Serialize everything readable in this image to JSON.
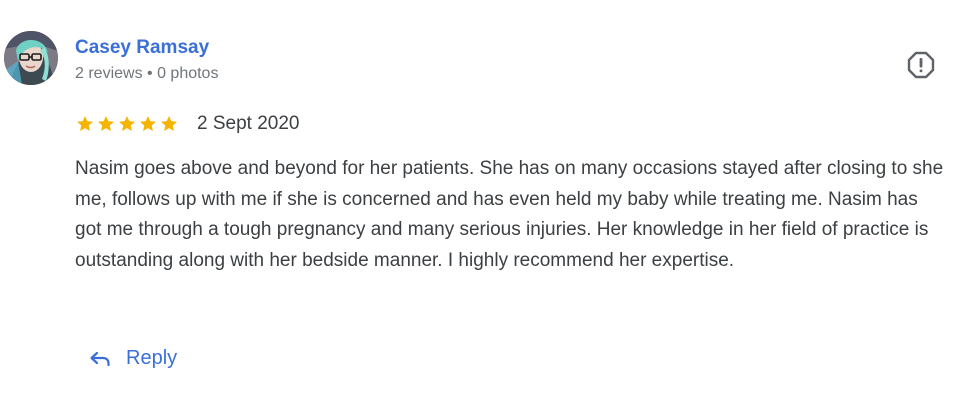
{
  "review": {
    "author": {
      "name": "Casey Ramsay",
      "meta": "2 reviews • 0 photos",
      "avatar_icon": "profile-photo"
    },
    "rating": 5,
    "rating_max": 5,
    "date": "2 Sept 2020",
    "text": "Nasim goes above and beyond for her patients. She has on many occasions stayed after closing to she me, follows up with me if she is concerned and has even held my baby while treating me. Nasim has got me through a tough pregnancy and many serious injuries. Her knowledge in her field of practice is outstanding along with her bedside manner. I highly recommend her expertise.",
    "actions": {
      "reply_label": "Reply",
      "reply_icon": "reply-arrow-icon",
      "flag_icon": "report-flag-icon"
    }
  },
  "colors": {
    "accent": "#3a6fd8",
    "star": "#f4b400",
    "text": "#3c4043",
    "muted": "#70757a"
  }
}
